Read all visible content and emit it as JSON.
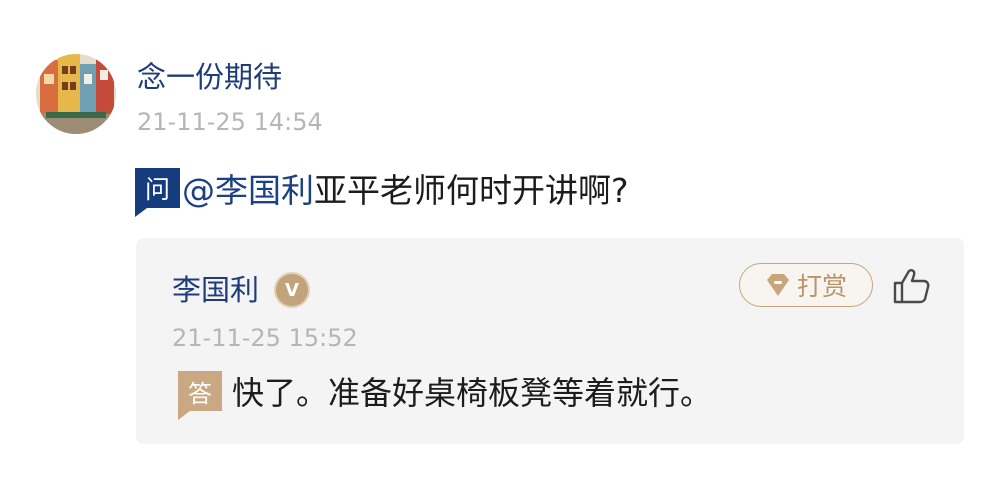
{
  "question_post": {
    "user_name": "念一份期待",
    "timestamp": "21-11-25 14:54",
    "badge_label": "问",
    "mention": "@李国利",
    "text": "亚平老师何时开讲啊?"
  },
  "answer_post": {
    "user_name": "李国利",
    "verified_badge": "V",
    "tip_label": "打赏",
    "timestamp": "21-11-25 15:52",
    "badge_label": "答",
    "text": "快了。准备好桌椅板凳等着就行。"
  },
  "icons": {
    "verified": "verified-v-icon",
    "tip": "diamond-icon",
    "like": "thumbs-up-icon"
  },
  "colors": {
    "username_blue": "#1f3c7a",
    "question_badge": "#153c7c",
    "answer_badge": "#caa883",
    "tip_gold": "#c9a57c",
    "timestamp_gray": "#b6b6b6",
    "card_bg": "#f4f4f4"
  }
}
